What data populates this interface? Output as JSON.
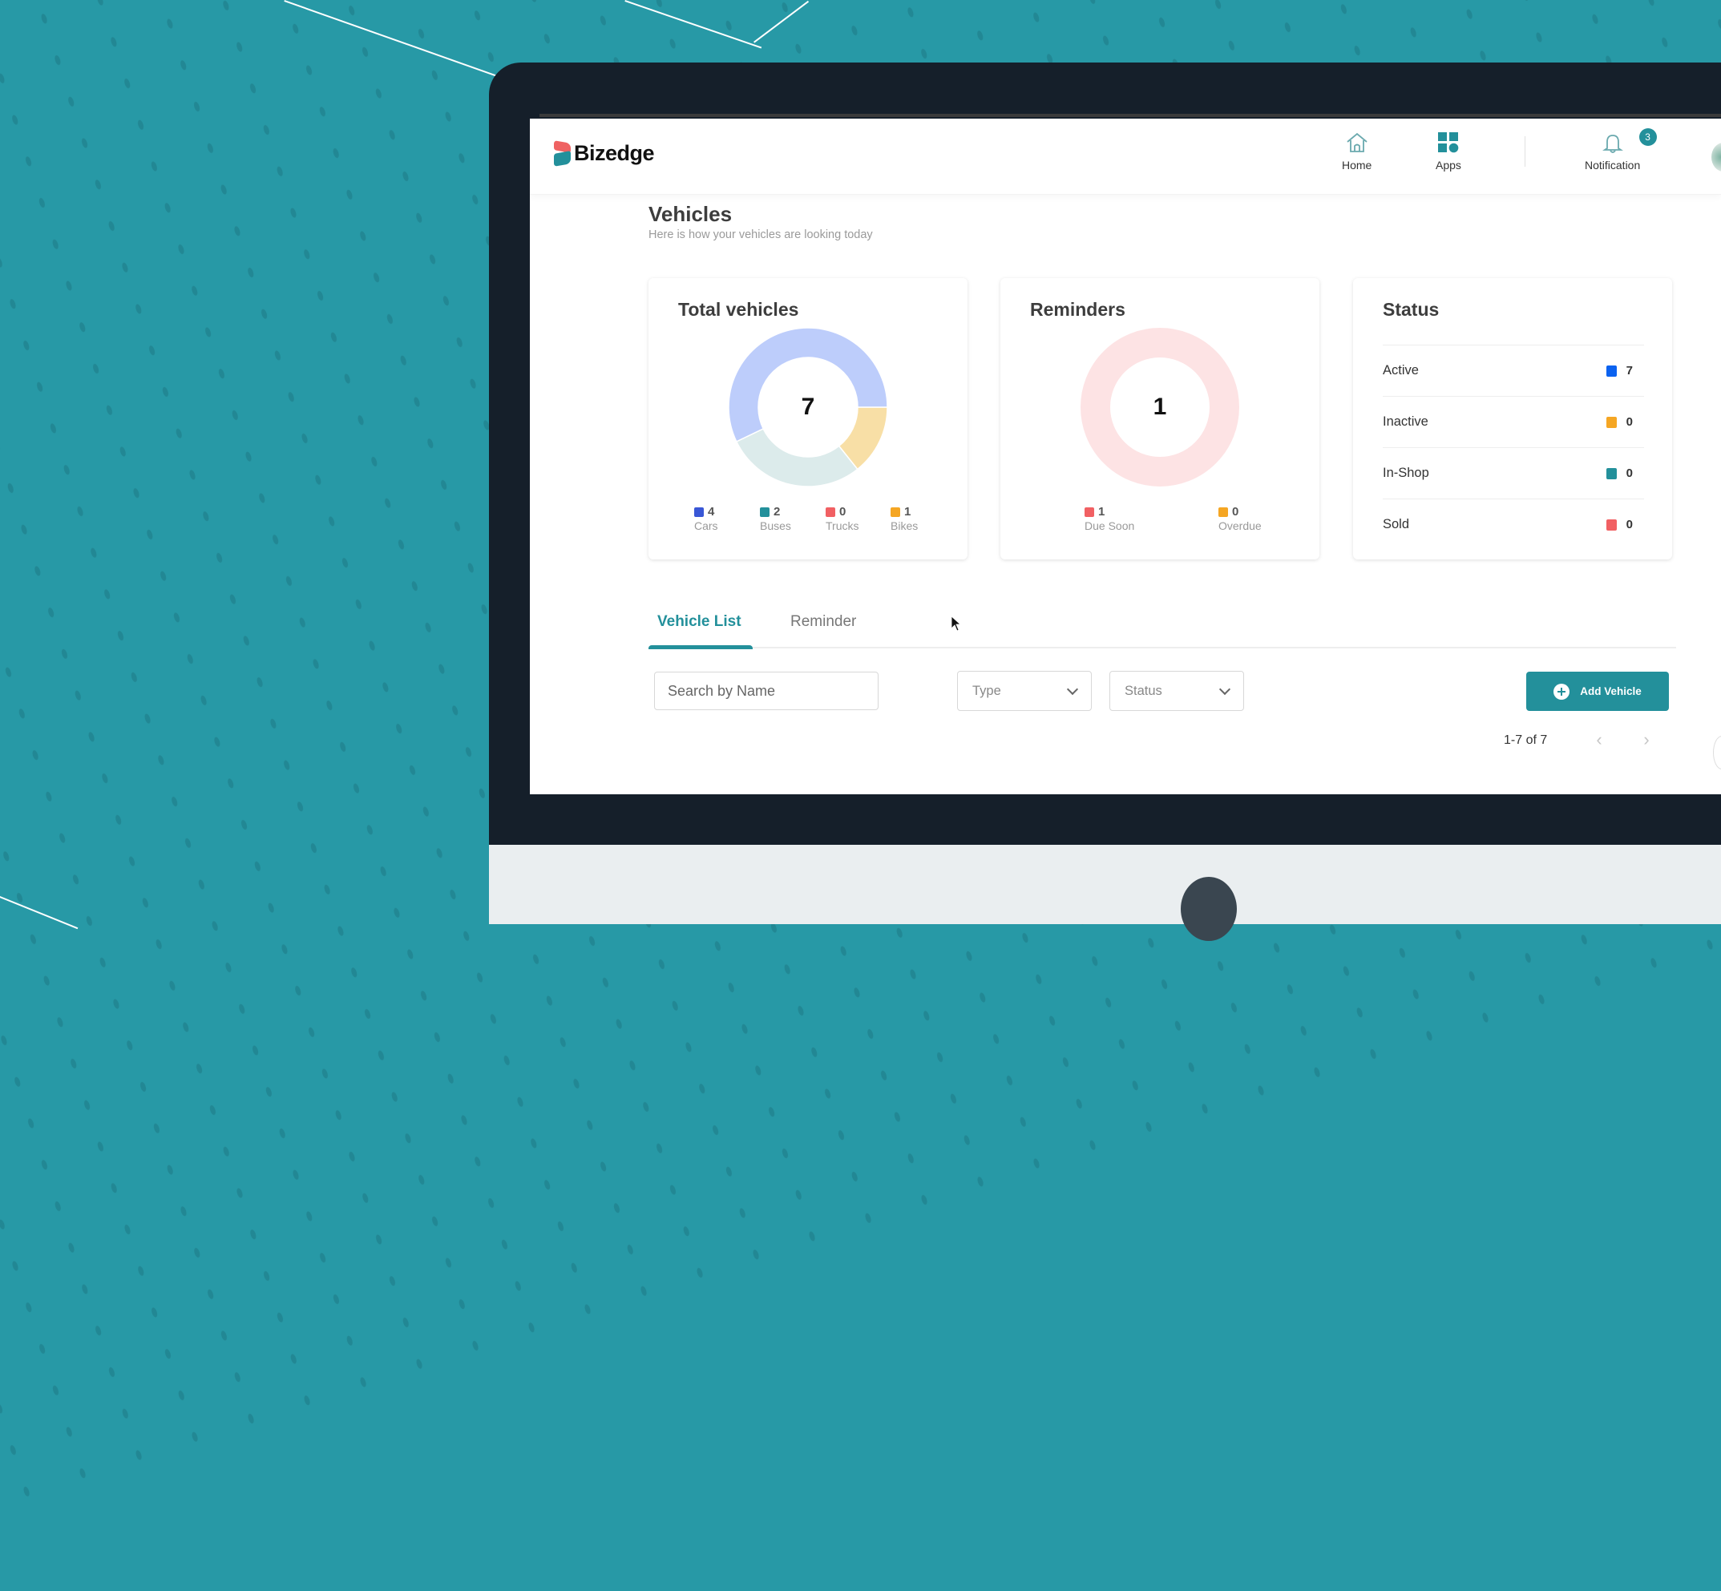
{
  "app": {
    "brand": "Bizedge",
    "nav": [
      {
        "label": "Home",
        "icon": "home-icon"
      },
      {
        "label": "Apps",
        "icon": "apps-grid-icon"
      },
      {
        "label": "Notification",
        "icon": "bell-icon",
        "badge": "3"
      }
    ]
  },
  "page": {
    "title": "Vehicles",
    "subtitle": "Here is how your vehicles are looking today"
  },
  "cards": {
    "total": {
      "title": "Total vehicles",
      "center_value": "7",
      "legend": [
        {
          "value": "4",
          "label": "Cars",
          "color": "#3957d6"
        },
        {
          "value": "2",
          "label": "Buses",
          "color": "#23909b"
        },
        {
          "value": "0",
          "label": "Trucks",
          "color": "#f16063"
        },
        {
          "value": "1",
          "label": "Bikes",
          "color": "#f5a623"
        }
      ]
    },
    "reminders": {
      "title": "Reminders",
      "center_value": "1",
      "legend": [
        {
          "value": "1",
          "label": "Due Soon",
          "color": "#f16063"
        },
        {
          "value": "0",
          "label": "Overdue",
          "color": "#f5a623"
        }
      ]
    },
    "status": {
      "title": "Status",
      "rows": [
        {
          "label": "Active",
          "value": "7",
          "color": "#0b62f0"
        },
        {
          "label": "Inactive",
          "value": "0",
          "color": "#f5a623"
        },
        {
          "label": "In-Shop",
          "value": "0",
          "color": "#23909b"
        },
        {
          "label": "Sold",
          "value": "0",
          "color": "#f16063"
        }
      ]
    }
  },
  "chart_data": [
    {
      "type": "pie",
      "title": "Total vehicles",
      "categories": [
        "Bikes",
        "Trucks",
        "Buses",
        "Cars"
      ],
      "values": [
        1,
        0,
        2,
        4
      ],
      "colors": [
        "#f8dfa6",
        "#fbd0d1",
        "#dcebeb",
        "#bdcdfb"
      ],
      "center_label": "7"
    },
    {
      "type": "pie",
      "title": "Reminders",
      "categories": [
        "Due Soon",
        "Overdue"
      ],
      "values": [
        1,
        0
      ],
      "colors": [
        "#fde3e4",
        "#fdeccb"
      ],
      "center_label": "1"
    }
  ],
  "tabs": [
    {
      "label": "Vehicle List",
      "active": true
    },
    {
      "label": "Reminder",
      "active": false
    }
  ],
  "toolbar": {
    "search_placeholder": "Search by Name",
    "type_select": "Type",
    "status_select": "Status",
    "add_button": "Add Vehicle"
  },
  "pagination": {
    "range_text": "1-7 of 7",
    "prev": "‹",
    "next": "›"
  }
}
